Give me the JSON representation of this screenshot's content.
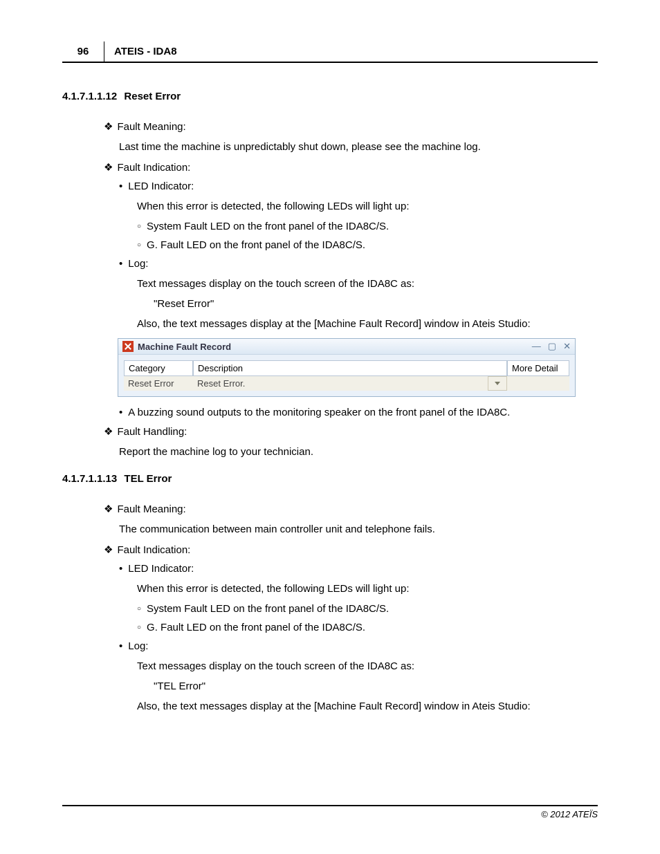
{
  "header": {
    "page_number": "96",
    "title": "ATEIS - IDA8"
  },
  "sections": [
    {
      "num": "4.1.7.1.1.12",
      "title": "Reset Error",
      "fault_meaning_label": "Fault Meaning:",
      "fault_meaning_text": "Last time the machine is unpredictably shut down, please see the machine log.",
      "fault_indication_label": "Fault Indication:",
      "led_label": "LED Indicator:",
      "led_intro": "When this error is detected, the following LEDs will light up:",
      "led_items": [
        "System Fault LED on the front panel of the IDA8C/S.",
        "G. Fault LED on the front panel of the IDA8C/S."
      ],
      "log_label": "Log:",
      "log_text1": "Text messages display on the touch screen of the IDA8C as:",
      "log_quote": "\"Reset Error\"",
      "log_text2": "Also, the text messages display at the [Machine Fault Record] window in Ateis Studio:",
      "window": {
        "title": "Machine Fault Record",
        "cols": {
          "category": "Category",
          "description": "Description",
          "detail": "More Detail"
        },
        "row": {
          "category": "Reset Error",
          "description": "Reset Error."
        }
      },
      "buzz": "A buzzing sound outputs to the monitoring speaker on the front panel of the IDA8C.",
      "fault_handling_label": "Fault Handling:",
      "fault_handling_text": "Report the machine log to your technician."
    },
    {
      "num": "4.1.7.1.1.13",
      "title": "TEL Error",
      "fault_meaning_label": "Fault Meaning:",
      "fault_meaning_text": "The communication between main controller unit and telephone fails.",
      "fault_indication_label": "Fault Indication:",
      "led_label": "LED Indicator:",
      "led_intro": "When this error is detected, the following LEDs will light up:",
      "led_items": [
        "System Fault LED on the front panel of the IDA8C/S.",
        "G. Fault LED on the front panel of the IDA8C/S."
      ],
      "log_label": "Log:",
      "log_text1": "Text messages display on the touch screen of the IDA8C as:",
      "log_quote": "\"TEL Error\"",
      "log_text2": "Also, the text messages display at the [Machine Fault Record] window in Ateis Studio:"
    }
  ],
  "footer": "© 2012 ATEÏS"
}
